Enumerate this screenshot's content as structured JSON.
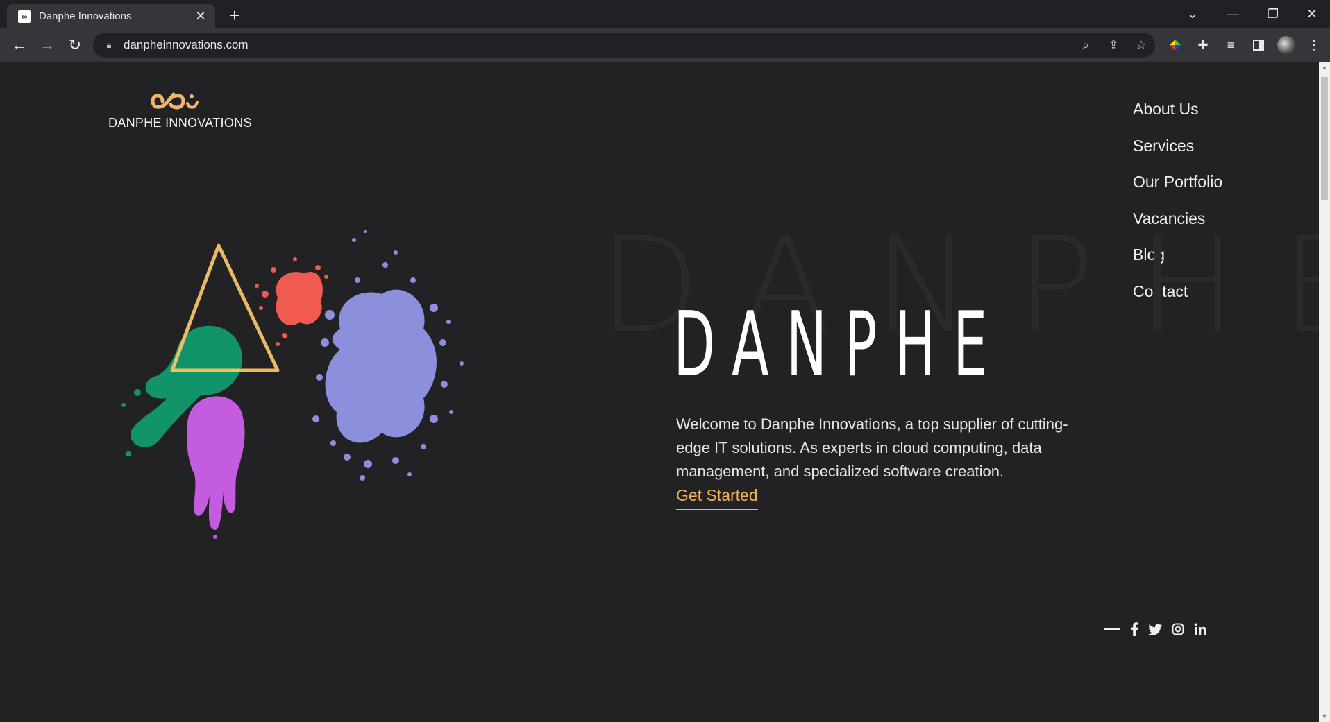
{
  "browser": {
    "tab_title": "Danphe Innovations",
    "url": "danpheinnovations.com"
  },
  "site": {
    "logo_text": "DANPHE INNOVATIONS",
    "nav": [
      {
        "label": "About Us"
      },
      {
        "label": "Services"
      },
      {
        "label": "Our Portfolio"
      },
      {
        "label": "Vacancies"
      },
      {
        "label": "Blog"
      },
      {
        "label": "Contact"
      }
    ],
    "watermark": "DANPHE",
    "hero_title": "DANPHE",
    "hero_text": "Welcome to Danphe Innovations, a top supplier of cutting-edge IT solutions. As experts in cloud computing, data management, and specialized software creation.",
    "cta_label": "Get Started",
    "social": [
      "facebook-icon",
      "twitter-icon",
      "instagram-icon",
      "linkedin-icon"
    ]
  },
  "colors": {
    "background": "#222224",
    "accent": "#f3b05a",
    "splash_red": "#f05a4f",
    "splash_green": "#11946a",
    "splash_blue": "#8c8fdc",
    "splash_purple": "#c45ce0"
  }
}
